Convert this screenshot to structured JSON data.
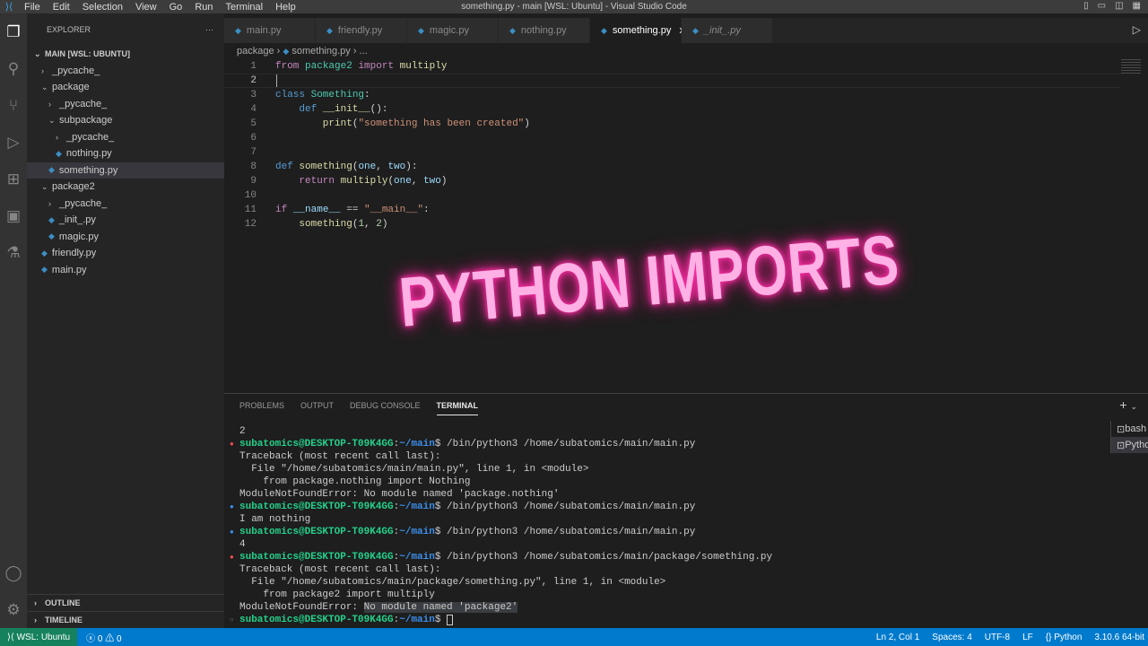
{
  "titlebar": {
    "title": "something.py - main [WSL: Ubuntu] - Visual Studio Code",
    "menu": [
      "File",
      "Edit",
      "Selection",
      "View",
      "Go",
      "Run",
      "Terminal",
      "Help"
    ]
  },
  "sidebar": {
    "header": "EXPLORER",
    "more": "···",
    "root": "MAIN [WSL: UBUNTU]",
    "items": [
      {
        "label": "_pycache_",
        "depth": 1,
        "type": "folder",
        "open": false
      },
      {
        "label": "package",
        "depth": 1,
        "type": "folder",
        "open": true
      },
      {
        "label": "_pycache_",
        "depth": 2,
        "type": "folder",
        "open": false
      },
      {
        "label": "subpackage",
        "depth": 2,
        "type": "folder",
        "open": true
      },
      {
        "label": "_pycache_",
        "depth": 3,
        "type": "folder",
        "open": false
      },
      {
        "label": "nothing.py",
        "depth": 3,
        "type": "file"
      },
      {
        "label": "something.py",
        "depth": 2,
        "type": "file",
        "selected": true
      },
      {
        "label": "package2",
        "depth": 1,
        "type": "folder",
        "open": true
      },
      {
        "label": "_pycache_",
        "depth": 2,
        "type": "folder",
        "open": false
      },
      {
        "label": "_init_.py",
        "depth": 2,
        "type": "file"
      },
      {
        "label": "magic.py",
        "depth": 2,
        "type": "file"
      },
      {
        "label": "friendly.py",
        "depth": 1,
        "type": "file"
      },
      {
        "label": "main.py",
        "depth": 1,
        "type": "file"
      }
    ],
    "outline": "OUTLINE",
    "timeline": "TIMELINE"
  },
  "tabs": [
    {
      "label": "main.py"
    },
    {
      "label": "friendly.py"
    },
    {
      "label": "magic.py"
    },
    {
      "label": "nothing.py"
    },
    {
      "label": "something.py",
      "active": true
    },
    {
      "label": "_init_.py",
      "italic": true
    }
  ],
  "breadcrumb": {
    "folder": "package",
    "file": "something.py",
    "more": "..."
  },
  "code": [
    [
      [
        "from ",
        "kw"
      ],
      [
        "package2 ",
        "cls"
      ],
      [
        "import ",
        "kw"
      ],
      [
        "multiply",
        "fn"
      ]
    ],
    [],
    [
      [
        "class ",
        "kb"
      ],
      [
        "Something",
        "cls"
      ],
      [
        ":",
        "pl"
      ]
    ],
    [
      [
        "    def ",
        "kb"
      ],
      [
        "__init__",
        "fn"
      ],
      [
        "():",
        "pl"
      ]
    ],
    [
      [
        "        print",
        "fn"
      ],
      [
        "(",
        "pl"
      ],
      [
        "\"something has been created\"",
        "str"
      ],
      [
        ")",
        "pl"
      ]
    ],
    [],
    [],
    [
      [
        "def ",
        "kb"
      ],
      [
        "something",
        "fn"
      ],
      [
        "(",
        "pl"
      ],
      [
        "one",
        "var"
      ],
      [
        ", ",
        "pl"
      ],
      [
        "two",
        "var"
      ],
      [
        "):",
        "pl"
      ]
    ],
    [
      [
        "    return ",
        "kw"
      ],
      [
        "multiply",
        "fn"
      ],
      [
        "(",
        "pl"
      ],
      [
        "one",
        "var"
      ],
      [
        ", ",
        "pl"
      ],
      [
        "two",
        "var"
      ],
      [
        ")",
        "pl"
      ]
    ],
    [],
    [
      [
        "if ",
        "kw"
      ],
      [
        "__name__",
        "var"
      ],
      [
        " == ",
        "pl"
      ],
      [
        "\"__main__\"",
        "str"
      ],
      [
        ":",
        "pl"
      ]
    ],
    [
      [
        "    something",
        "fn"
      ],
      [
        "(",
        "pl"
      ],
      [
        "1",
        "num"
      ],
      [
        ", ",
        "pl"
      ],
      [
        "2",
        "num"
      ],
      [
        ")",
        "pl"
      ]
    ]
  ],
  "overlay": "PYTHON IMPORTS",
  "panel": {
    "tabs": [
      "PROBLEMS",
      "OUTPUT",
      "DEBUG CONSOLE",
      "TERMINAL"
    ],
    "active": "TERMINAL",
    "terminals": [
      "bash",
      "Python"
    ]
  },
  "terminal": [
    {
      "text": "2"
    },
    {
      "dot": "err",
      "user": "subatomics@DESKTOP-T09K4GG",
      "path": "~/main",
      "cmd": "$ /bin/python3 /home/subatomics/main/main.py"
    },
    {
      "text": "Traceback (most recent call last):"
    },
    {
      "text": "  File \"/home/subatomics/main/main.py\", line 1, in <module>"
    },
    {
      "text": "    from package.nothing import Nothing"
    },
    {
      "text": "ModuleNotFoundError: No module named 'package.nothing'"
    },
    {
      "dot": "ok",
      "user": "subatomics@DESKTOP-T09K4GG",
      "path": "~/main",
      "cmd": "$ /bin/python3 /home/subatomics/main/main.py"
    },
    {
      "text": "I am nothing"
    },
    {
      "dot": "ok",
      "user": "subatomics@DESKTOP-T09K4GG",
      "path": "~/main",
      "cmd": "$ /bin/python3 /home/subatomics/main/main.py"
    },
    {
      "text": "4"
    },
    {
      "dot": "err",
      "user": "subatomics@DESKTOP-T09K4GG",
      "path": "~/main",
      "cmd": "$ /bin/python3 /home/subatomics/main/package/something.py"
    },
    {
      "text": "Traceback (most recent call last):"
    },
    {
      "text": "  File \"/home/subatomics/main/package/something.py\", line 1, in <module>"
    },
    {
      "text": "    from package2 import multiply"
    },
    {
      "text": "ModuleNotFoundError: ",
      "hl": "No module named 'package2'"
    },
    {
      "dot": "none",
      "user": "subatomics@DESKTOP-T09K4GG",
      "path": "~/main",
      "cmd": "$ ",
      "cursor": true
    }
  ],
  "statusbar": {
    "remote": "WSL: Ubuntu",
    "errors": "0",
    "warnings": "0",
    "position": "Ln 2, Col 1",
    "spaces": "Spaces: 4",
    "encoding": "UTF-8",
    "eol": "LF",
    "language": "Python",
    "interpreter": "3.10.6 64-bit"
  }
}
